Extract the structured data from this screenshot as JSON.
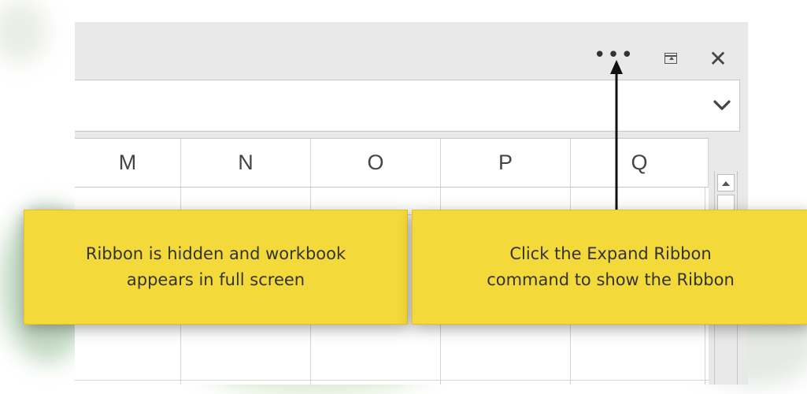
{
  "title_bar": {
    "more_label": "•••",
    "close_label": "✕"
  },
  "columns": [
    "M",
    "N",
    "O",
    "P",
    "Q"
  ],
  "callouts": {
    "hidden": {
      "line1": "Ribbon is hidden and workbook",
      "line2": "appears in full screen"
    },
    "expand": {
      "line1": "Click the Expand Ribbon",
      "line2": "command to show the Ribbon"
    }
  },
  "colors": {
    "callout_fill": "#f3d93a",
    "window_chrome": "#e9e9e9",
    "gridline": "#d4d4d4",
    "arrow": "#111111"
  },
  "icons": {
    "more": "ellipsis-icon",
    "restore": "restore-ribbon-icon",
    "close": "close-icon",
    "expand": "chevron-down-icon",
    "scroll_up": "triangle-up-icon"
  }
}
